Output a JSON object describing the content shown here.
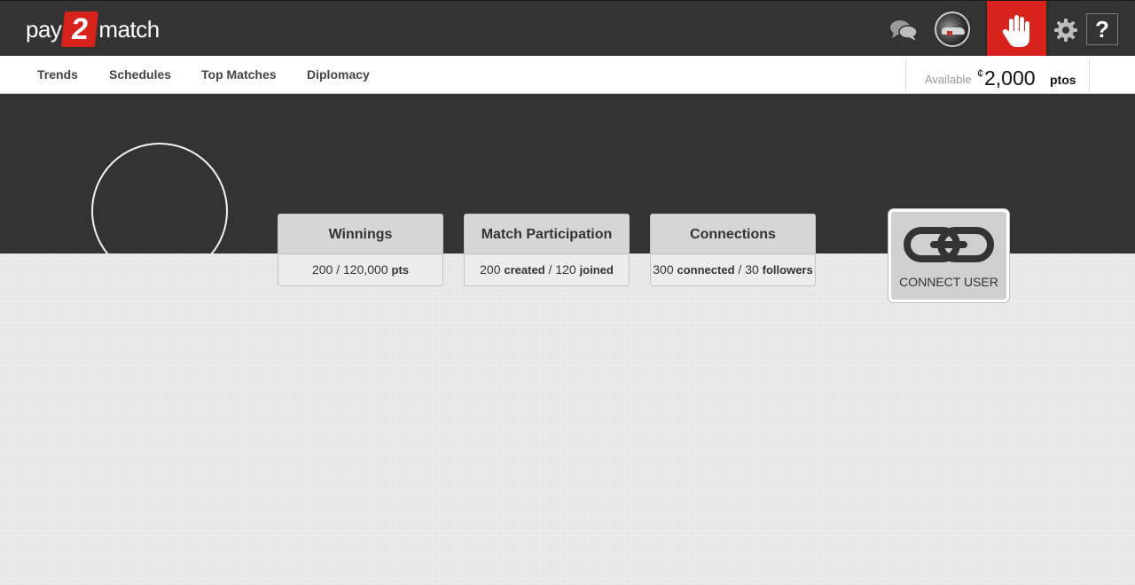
{
  "header": {
    "logo": {
      "pre": "pay",
      "number": "2",
      "post": "match"
    },
    "icons": {
      "chat": "chat-bubbles-icon",
      "avatar": "user-avatar",
      "hand": "raise-hand-icon",
      "settings": "gear-icon",
      "help": "?"
    },
    "accent_color": "#d7231c"
  },
  "nav": {
    "items": [
      "Trends",
      "Schedules",
      "Top Matches",
      "Diplomacy"
    ]
  },
  "balance": {
    "label": "Available",
    "currency_symbol": "¢",
    "amount": "2,000",
    "unit": "ptos"
  },
  "stats": [
    {
      "title": "Winnings",
      "v1": "200",
      "sep": " / ",
      "v2": "120,000",
      "w2": "pts"
    },
    {
      "title": "Match Participation",
      "v1": "200",
      "w1": "created",
      "sep": " / ",
      "v2": "120",
      "w2": "joined"
    },
    {
      "title": "Connections",
      "v1": "300",
      "w1": "connected",
      "sep": " / ",
      "v2": "30",
      "w2": "followers"
    }
  ],
  "connect": {
    "label": "CONNECT USER",
    "icon": "chain-link-icon"
  }
}
